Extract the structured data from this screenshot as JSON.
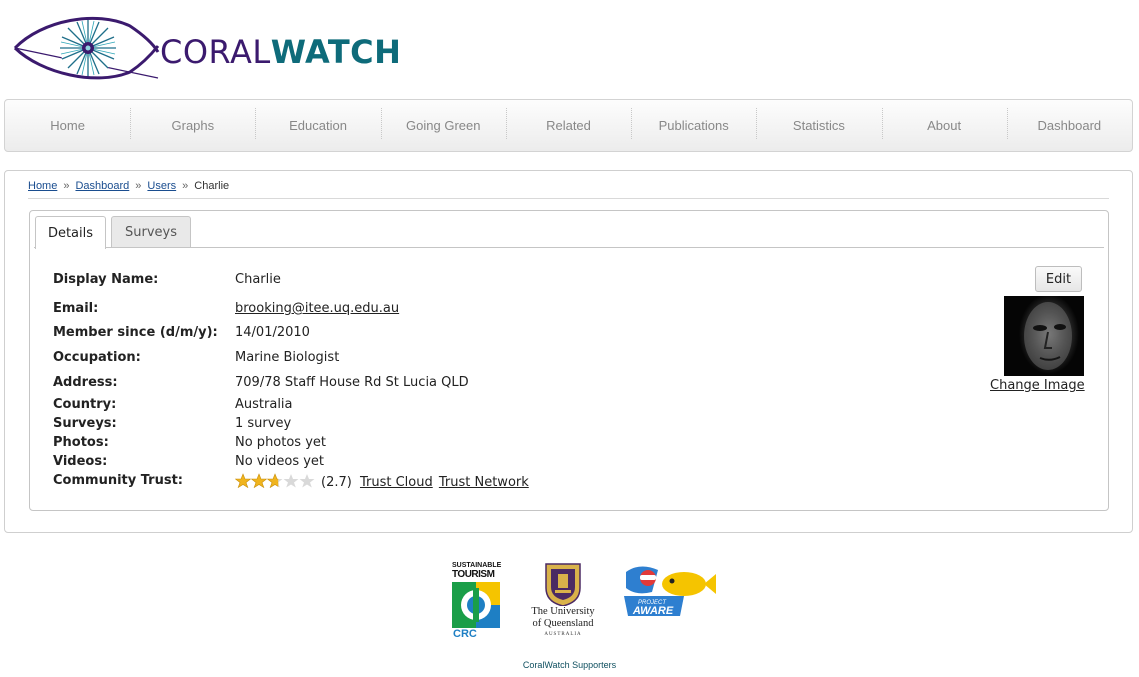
{
  "brand": {
    "part1": "CORAL",
    "part2": "WATCH"
  },
  "nav": [
    {
      "label": "Home"
    },
    {
      "label": "Graphs"
    },
    {
      "label": "Education"
    },
    {
      "label": "Going Green"
    },
    {
      "label": "Related"
    },
    {
      "label": "Publications"
    },
    {
      "label": "Statistics"
    },
    {
      "label": "About"
    },
    {
      "label": "Dashboard"
    }
  ],
  "breadcrumb": {
    "home": "Home",
    "dashboard": "Dashboard",
    "users": "Users",
    "current": "Charlie",
    "separator": "»"
  },
  "tabs": {
    "details": "Details",
    "surveys": "Surveys"
  },
  "profile": {
    "display_name": {
      "label": "Display Name:",
      "value": "Charlie"
    },
    "email": {
      "label": "Email:",
      "value": "brooking@itee.uq.edu.au"
    },
    "member_since": {
      "label": "Member since (d/m/y):",
      "value": "14/01/2010"
    },
    "occupation": {
      "label": "Occupation:",
      "value": "Marine Biologist"
    },
    "address": {
      "label": "Address:",
      "value": "709/78 Staff House Rd St Lucia QLD"
    },
    "country": {
      "label": "Country:",
      "value": "Australia"
    },
    "surveys": {
      "label": "Surveys:",
      "value": "1 survey"
    },
    "photos": {
      "label": "Photos:",
      "value": "No photos yet"
    },
    "videos": {
      "label": "Videos:",
      "value": "No videos yet"
    },
    "community_trust": {
      "label": "Community Trust:",
      "rating": 2.7,
      "max": 5,
      "rating_text": "(2.7)",
      "trust_cloud": "Trust Cloud",
      "trust_network": "Trust Network"
    }
  },
  "actions": {
    "edit": "Edit",
    "change_image": "Change Image"
  },
  "footer": {
    "crc": {
      "line1": "SUSTAINABLE",
      "line2": "TOURISM",
      "line3": "CRC"
    },
    "uq": {
      "name1": "The University",
      "name2": "of Queensland",
      "sub": "AUSTRALIA"
    },
    "aware": {
      "line1": "PROJECT",
      "line2": "AWARE"
    },
    "caption": "CoralWatch Supporters"
  },
  "colors": {
    "brand_purple": "#3b1a6e",
    "brand_teal": "#0e6b7a",
    "link_blue": "#1a4d8f",
    "star_gold": "#f0b41e",
    "star_empty": "#d9d9d9"
  }
}
